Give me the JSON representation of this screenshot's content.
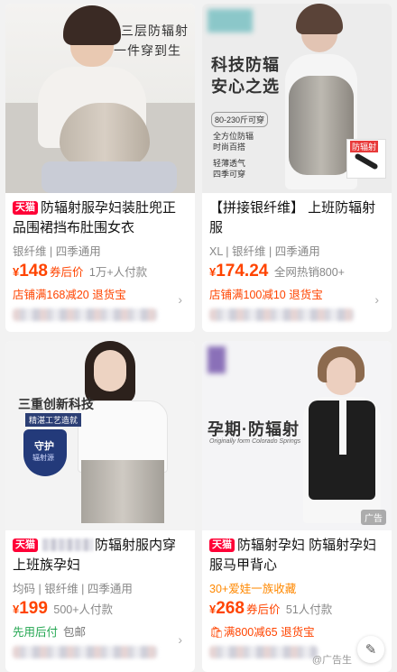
{
  "products": [
    {
      "overlay": [
        "三层防辐射",
        "一件穿到生"
      ],
      "badge": "天猫",
      "title": "防辐射服孕妇装肚兜正品围裙挡布肚围女衣",
      "attrs": "银纤维 | 四季通用",
      "yen": "¥",
      "price": "148",
      "price_tag": "券后价",
      "sold": "1万+人付款",
      "promo": "店铺满168减20 退货宝"
    },
    {
      "overlay": [
        "科技防辐",
        "安心之选"
      ],
      "sizes": "80-230斤可穿",
      "features": [
        "全方位防辐",
        "时尚百搭"
      ],
      "features2": [
        "轻薄透气",
        "四季可穿"
      ],
      "tag": "防辐射",
      "title": "【拼接银纤维】 上班防辐射服",
      "attrs": "XL | 银纤维 | 四季通用",
      "yen": "¥",
      "price": "174.24",
      "sold": "全网热销800+",
      "promo": "店铺满100减10 退货宝"
    },
    {
      "overlay": [
        "三重创新科技"
      ],
      "craft": "精湛工艺造就",
      "shield": "守护",
      "shield_sub": "辐射源",
      "badge": "天猫",
      "title": "防辐射服内穿上班族孕妇",
      "attrs": "均码 | 银纤维 | 四季通用",
      "yen": "¥",
      "price": "199",
      "sold": "500+人付款",
      "promo_green": "先用后付",
      "promo_gray": "包邮"
    },
    {
      "overlay": [
        "孕期·防辐射"
      ],
      "overlay_sub": "Originally form Colorado Springs",
      "ad": "广告",
      "badge": "天猫",
      "title": "防辐射孕妇 防辐射孕妇服马甲背心",
      "attrs": "30+爱娃一族收藏",
      "yen": "¥",
      "price": "268",
      "price_tag": "券后价",
      "sold": "51人付款",
      "promo": "满800减65 退货宝"
    }
  ],
  "watermark": "@广告生"
}
